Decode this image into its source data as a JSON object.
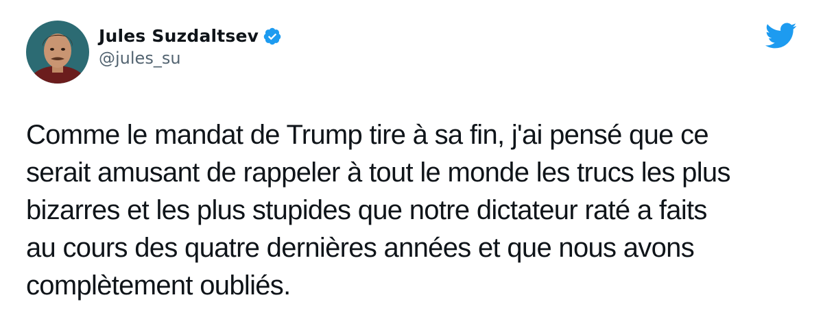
{
  "tweet": {
    "display_name": "Jules Suzdaltsev",
    "handle": "@jules_su",
    "verified": true,
    "verified_icon": "verified-badge-icon",
    "platform_icon": "twitter-bird-icon",
    "accent_color": "#1d9bf0",
    "text": "Comme le mandat de Trump tire à sa fin, j'ai pensé que ce\nserait amusant de rappeler à tout le monde les trucs les plus\nbizarres et les plus stupides que notre dictateur raté a faits\nau cours des quatre dernières années et que nous avons\ncomplètement oubliés."
  }
}
